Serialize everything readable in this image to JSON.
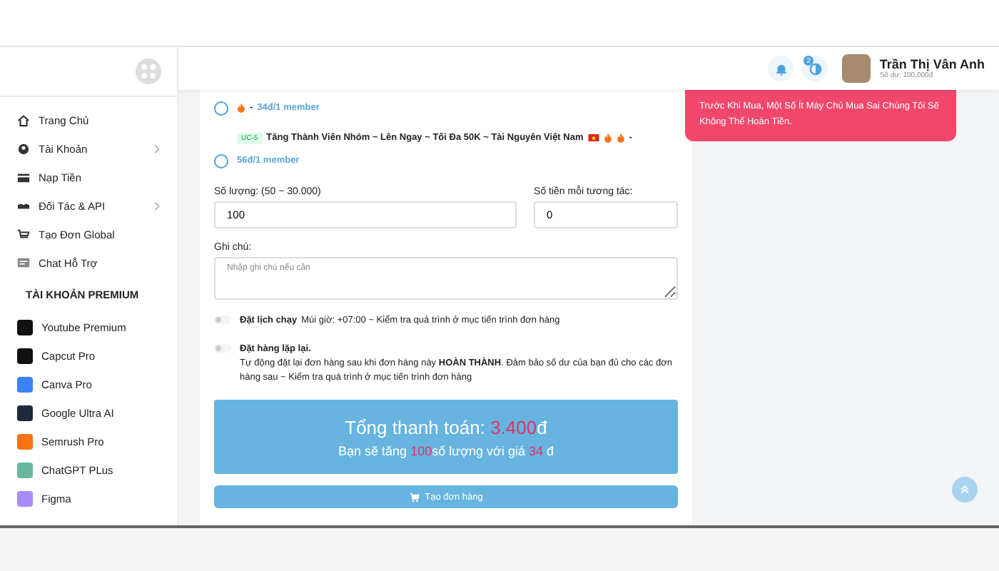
{
  "sidebar": {
    "items": [
      {
        "label": "Trang Chủ",
        "expandable": false
      },
      {
        "label": "Tài Khoản",
        "expandable": true
      },
      {
        "label": "Nạp Tiền",
        "expandable": false
      },
      {
        "label": "Đối Tác & API",
        "expandable": true
      },
      {
        "label": "Tạo Đơn Global",
        "expandable": false
      },
      {
        "label": "Chat Hỗ Trợ",
        "expandable": false
      }
    ],
    "section_title": "TÀI KHOẢN PREMIUM",
    "premium_items": [
      {
        "label": "Youtube Premium",
        "color": "#111111"
      },
      {
        "label": "Capcut Pro",
        "color": "#111111"
      },
      {
        "label": "Canva Pro",
        "color": "#3b82f6"
      },
      {
        "label": "Google Ultra AI",
        "color": "#1e293b"
      },
      {
        "label": "Semrush Pro",
        "color": "#f97316"
      },
      {
        "label": "ChatGPT PLus",
        "color": "#6ab7a0"
      },
      {
        "label": "Figma",
        "color": "#a78bfa"
      }
    ]
  },
  "header": {
    "notification_count": "2",
    "user_name": "Trần Thị Vân Anh",
    "balance": "Số dư: 100,000đ"
  },
  "alert": {
    "text": "Trước Khi Mua, Một Số Ít Máy Chủ Mua Sai Chúng Tôi Sẽ Không Thể Hoàn Tiền."
  },
  "options": [
    {
      "separator": "-",
      "price": "34đ/1 member",
      "selected": false
    },
    {
      "tag": "UC-5",
      "title": "Tăng Thành Viên Nhóm ~ Lên Ngay ~ Tối Đa 50K ~ Tài Nguyên Việt Nam",
      "separator": "-",
      "price": "56đ/1 member",
      "selected": false
    }
  ],
  "quantity": {
    "label": "Số lượng: (50 ~ 30.000)",
    "value": "100"
  },
  "unit_price": {
    "label": "Số tiền mỗi tương tác:",
    "value": "0"
  },
  "note": {
    "label": "Ghi chú:",
    "placeholder": "Nhập ghi chú nếu cần"
  },
  "toggles": [
    {
      "title": "Đặt lịch chạy",
      "text": "Múi giờ: +07:00 ~ Kiểm tra quá trình ở mục tiến trình đơn hàng",
      "on": false
    },
    {
      "title": "Đặt hàng lặp lại.",
      "text": "Tự động đặt lại đơn hàng sau khi đơn hàng này **HOÀN THÀNH**. Đảm bảo số dư của bạn đủ cho các đơn hàng sau ~ Kiểm tra quá trình ở mục tiến trình đơn hàng",
      "on": false
    }
  ],
  "summary": {
    "total_label": "Tổng thanh toán:",
    "total_value": "3.400",
    "total_unit": "đ",
    "line_start": "Bạn sẽ tăng",
    "line_quantity": "100",
    "line_middle": "số lượng với giá",
    "line_price": "34",
    "line_unit": "đ"
  },
  "submit_button": "Tạo đơn hàng"
}
